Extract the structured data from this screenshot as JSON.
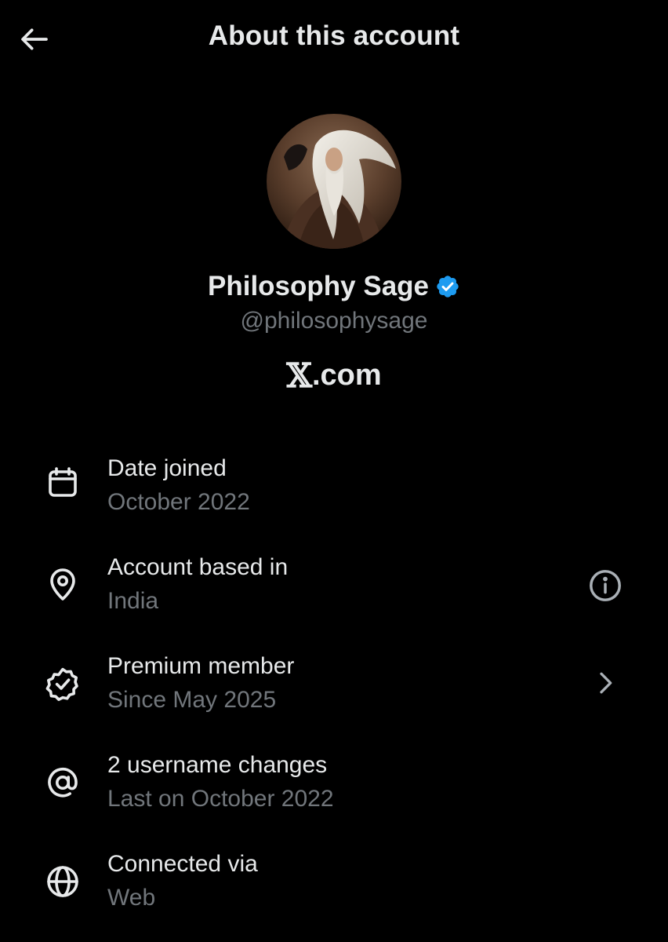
{
  "header": {
    "title": "About this account",
    "back_icon": "arrow-left-icon"
  },
  "profile": {
    "display_name": "Philosophy Sage",
    "handle": "@philosophysage",
    "verified": true,
    "verified_color": "#1d9bf0",
    "site_logo": "𝕏",
    "site_domain": ".com"
  },
  "info_rows": [
    {
      "icon": "calendar-icon",
      "title": "Date joined",
      "subtitle": "October 2022"
    },
    {
      "icon": "location-pin-icon",
      "title": "Account based in",
      "subtitle": "India",
      "action_icon": "info-icon"
    },
    {
      "icon": "verified-badge-outline-icon",
      "title": "Premium member",
      "subtitle": "Since May 2025",
      "action_icon": "chevron-right-icon"
    },
    {
      "icon": "at-sign-icon",
      "title": "2 username changes",
      "subtitle": "Last on October 2022"
    },
    {
      "icon": "globe-icon",
      "title": "Connected via",
      "subtitle": "Web"
    }
  ],
  "colors": {
    "background": "#000000",
    "primary_text": "#e7e9ea",
    "secondary_text": "#71767b",
    "accent": "#1d9bf0"
  }
}
